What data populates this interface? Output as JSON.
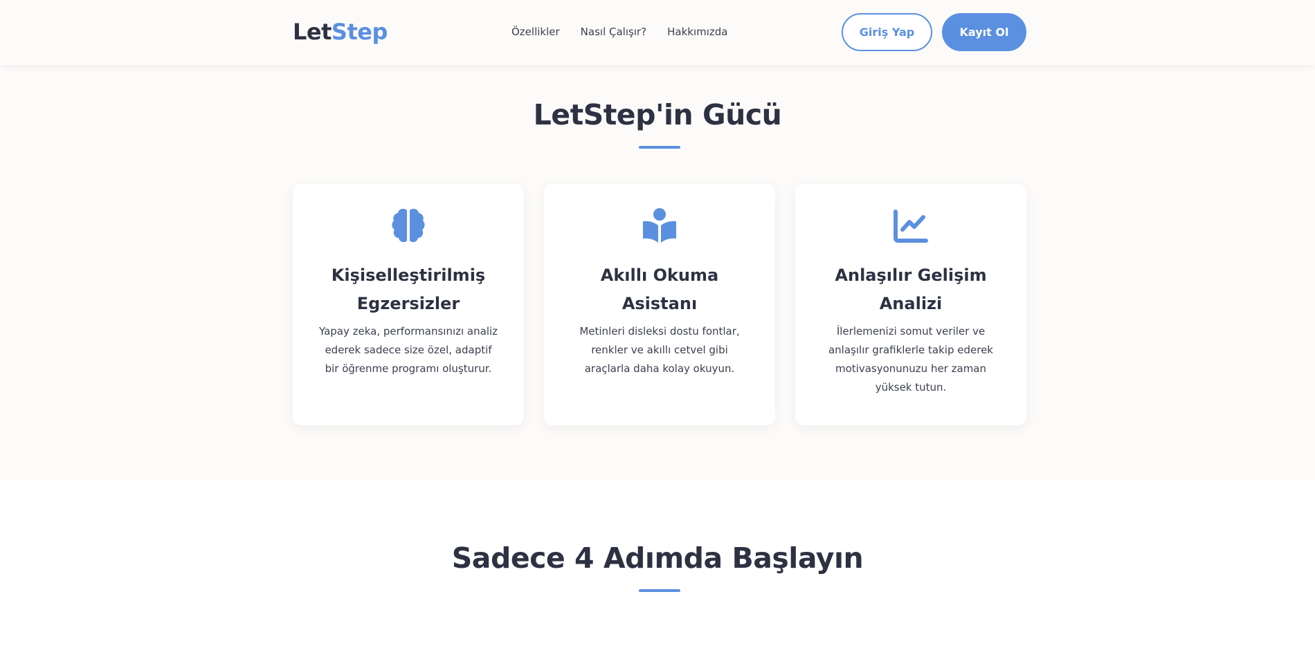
{
  "brand": {
    "part1": "Let",
    "part2": "Step"
  },
  "nav": {
    "items": [
      "Özellikler",
      "Nasıl Çalışır?",
      "Hakkımızda"
    ]
  },
  "auth": {
    "login_label": "Giriş Yap",
    "register_label": "Kayıt Ol"
  },
  "features": {
    "title": "LetStep'in Gücü",
    "cards": [
      {
        "icon": "brain-icon",
        "title_line1": "Kişiselleştirilmiş",
        "title_line2": "Egzersizler",
        "text": "Yapay zeka, performansınızı analiz ederek sadece size özel, adaptif bir öğrenme programı oluşturur."
      },
      {
        "icon": "book-reader-icon",
        "title_line1": "Akıllı Okuma",
        "title_line2": "Asistanı",
        "text": "Metinleri disleksi dostu fontlar, renkler ve akıllı cetvel gibi araçlarla daha kolay okuyun."
      },
      {
        "icon": "chart-line-icon",
        "title_line1": "Anlaşılır Gelişim",
        "title_line2": "Analizi",
        "text": "İlerlemenizi somut veriler ve anlaşılır grafiklerle takip ederek motivasyonunuzu her zaman yüksek tutun."
      }
    ]
  },
  "steps": {
    "title": "Sadece 4 Adımda Başlayın"
  },
  "colors": {
    "accent": "#5b8fe0",
    "text_dark": "#2d3142",
    "section_bg": "#fcfbfa"
  }
}
